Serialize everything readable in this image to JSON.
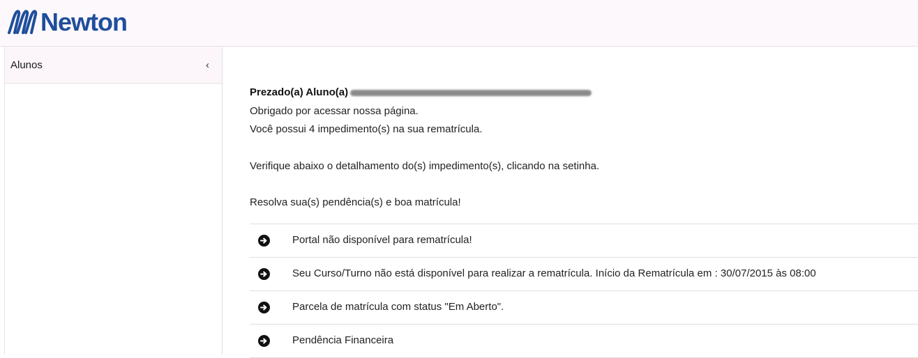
{
  "header": {
    "brand": "Newton"
  },
  "sidebar": {
    "items": [
      {
        "label": "Alunos",
        "chevron": "‹"
      }
    ]
  },
  "main": {
    "greeting_label": "Prezado(a) Aluno(a)",
    "line1": "Obrigado por acessar nossa página.",
    "line2": "Você possui 4 impedimento(s) na sua rematrícula.",
    "line3": "Verifique abaixo o detalhamento do(s) impedimento(s), clicando na setinha.",
    "line4": "Resolva sua(s) pendência(s) e boa matrícula!",
    "impedimentos": [
      {
        "text": "Portal não disponível para rematrícula!"
      },
      {
        "text": "Seu Curso/Turno não está disponível para realizar a rematrícula. Início da Rematrícula em : 30/07/2015 às 08:00"
      },
      {
        "text": "Parcela de matrícula com status \"Em Aberto\"."
      },
      {
        "text": "Pendência Financeira"
      }
    ]
  },
  "colors": {
    "brand": "#1f4e9c",
    "icon": "#111111"
  },
  "icons": {
    "logo": "newton-logo-icon",
    "row": "arrow-circle-right-icon",
    "sidebar": "chevron-left-icon"
  }
}
